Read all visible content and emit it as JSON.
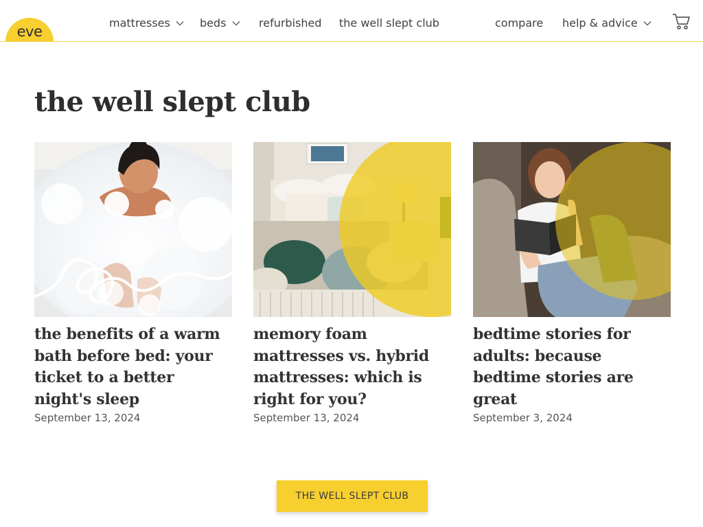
{
  "brand": {
    "logo_text": "eve",
    "accent_color": "#f7cf2e"
  },
  "nav": {
    "items": [
      {
        "label": "mattresses",
        "has_dropdown": true
      },
      {
        "label": "beds",
        "has_dropdown": true
      },
      {
        "label": "refurbished",
        "has_dropdown": false
      },
      {
        "label": "the well slept club",
        "has_dropdown": false
      },
      {
        "label": "compare",
        "has_dropdown": false
      },
      {
        "label": "help & advice",
        "has_dropdown": true
      }
    ],
    "cart_icon": "cart-icon"
  },
  "page": {
    "title": "the well slept club"
  },
  "articles": [
    {
      "title": "the benefits of a warm bath before bed: your ticket to a better night's sleep",
      "date": "September 13, 2024",
      "image": "woman-in-bubble-bath-photo"
    },
    {
      "title": "memory foam mattresses vs. hybrid mattresses: which is right for you?",
      "date": "September 13, 2024",
      "image": "bedroom-with-patterned-quilt-photo"
    },
    {
      "title": "bedtime stories for adults: because bedtime stories are great",
      "date": "September 3, 2024",
      "image": "girl-reading-book-on-couch-photo"
    }
  ],
  "cta": {
    "label": "THE WELL SLEPT CLUB"
  }
}
